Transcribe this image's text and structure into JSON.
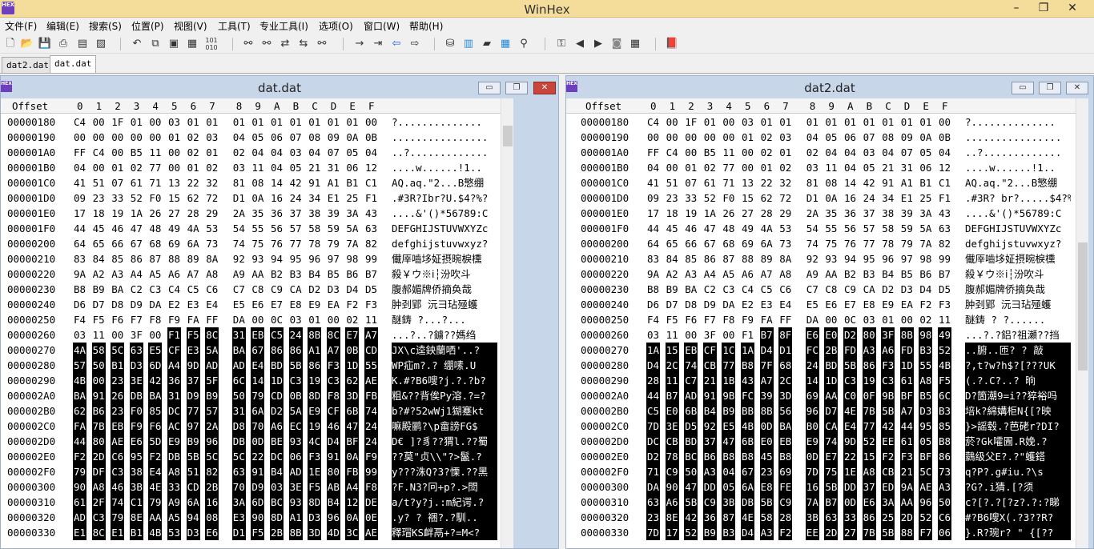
{
  "app": {
    "title": "WinHex",
    "logo_text": "HEX"
  },
  "window_controls": {
    "minimize": "–",
    "maximize": "❐",
    "close": "✕"
  },
  "menu": [
    "文件(F)",
    "编辑(E)",
    "搜索(S)",
    "位置(P)",
    "视图(V)",
    "工具(T)",
    "专业工具(I)",
    "选项(O)",
    "窗口(W)",
    "帮助(H)"
  ],
  "toolbar_icons": [
    "new-file-icon",
    "open-file-icon",
    "save-icon",
    "print-icon",
    "properties-icon",
    "open-folder-icon",
    "undo-icon",
    "copy-icon",
    "paste-icon",
    "clipboard-icon",
    "write-binary-icon",
    "find-text-icon",
    "find-hex-icon",
    "replace-text-icon",
    "replace-hex-icon",
    "find-again-icon",
    "goto-offset-icon",
    "goto-icon",
    "back-icon",
    "forward-icon",
    "disk-icon",
    "ram-icon",
    "memory-icon",
    "calculator-icon",
    "magnifier-icon",
    "toggle-icon",
    "prev-icon",
    "next-icon",
    "camera-icon",
    "table-icon",
    "book-icon"
  ],
  "tabs": [
    "dat2.dat",
    "dat.dat"
  ],
  "left": {
    "title": "dat.dat",
    "header": {
      "offset": "Offset",
      "cols": [
        "0",
        "1",
        "2",
        "3",
        "4",
        "5",
        "6",
        "7",
        "8",
        "9",
        "A",
        "B",
        "C",
        "D",
        "E",
        "F"
      ]
    },
    "offsets": [
      "00000180",
      "00000190",
      "000001A0",
      "000001B0",
      "000001C0",
      "000001D0",
      "000001E0",
      "000001F0",
      "00000200",
      "00000210",
      "00000220",
      "00000230",
      "00000240",
      "00000250",
      "00000260",
      "00000270",
      "00000280",
      "00000290",
      "000002A0",
      "000002B0",
      "000002C0",
      "000002D0",
      "000002E0",
      "000002F0",
      "00000300",
      "00000310",
      "00000320",
      "00000330"
    ],
    "rows": [
      "C4 00 1F 01 00 03 01 01 01 01 01 01 01 01 01 00",
      "00 00 00 00 00 01 02 03 04 05 06 07 08 09 0A 0B",
      "FF C4 00 B5 11 00 02 01 02 04 04 03 04 07 05 04",
      "04 00 01 02 77 00 01 02 03 11 04 05 21 31 06 12",
      "41 51 07 61 71 13 22 32 81 08 14 42 91 A1 B1 C1",
      "09 23 33 52 F0 15 62 72 D1 0A 16 24 34 E1 25 F1",
      "17 18 19 1A 26 27 28 29 2A 35 36 37 38 39 3A 43",
      "44 45 46 47 48 49 4A 53 54 55 56 57 58 59 5A 63",
      "64 65 66 67 68 69 6A 73 74 75 76 77 78 79 7A 82",
      "83 84 85 86 87 88 89 8A 92 93 94 95 96 97 98 99",
      "9A A2 A3 A4 A5 A6 A7 A8 A9 AA B2 B3 B4 B5 B6 B7",
      "B8 B9 BA C2 C3 C4 C5 C6 C7 C8 C9 CA D2 D3 D4 D5",
      "D6 D7 D8 D9 DA E2 E3 E4 E5 E6 E7 E8 E9 EA F2 F3",
      "F4 F5 F6 F7 F8 F9 FA FF DA 00 0C 03 01 00 02 11",
      "03 11 00 3F 00 F1 F5 8C 31 EB C5 24 8B 8C E7 A7",
      "4A 58 5C 63 E5 CF E3 5A BA 67 86 86 A1 A7 0B CD",
      "57 50 B1 D3 6D A4 9D AD AD E4 BD 5B 86 F3 1D 55",
      "4B 00 23 3E 42 36 37 5F 6C 14 1D C3 19 C3 62 AE",
      "BA 91 26 DB BA 31 D9 B9 50 79 CD 0B 8D F8 3D FB",
      "62 B6 23 F0 85 DC 77 57 31 6A D2 5A E9 CF 6B 74",
      "FA 7B EB F9 F6 AC 97 2A D8 70 A6 EC 19 46 47 24",
      "44 80 AE E6 5D E9 B9 96 DB 0D BE 93 4C D4 BF 24",
      "F2 2D C6 95 F2 DB 5B 5C 5C 22 DC 06 F3 91 0A F9",
      "79 DF C3 38 E4 A8 51 82 63 91 B4 AD 1E 80 FB 99",
      "90 A8 46 3B 4E 33 CD 2B 70 D9 03 3E F5 AB A4 F8",
      "61 2F 74 C1 79 A9 6A 16 3A 6D BC 93 8D B4 12 DE",
      "AD C3 79 8E AA A5 94 08 E3 90 8D A1 D3 96 0A 0E",
      "E1 8C E1 B1 4B 53 D3 E6 D1 F5 2B 8B 3D 4D 3C AE"
    ],
    "text": [
      "?..............",
      "................",
      "..?.............",
      "....w......!1..",
      "AQ.aq.\"2...B慜绷",
      ".#3R?Ibr?U.$4?%?",
      "....&'()*56789:C",
      "DEFGHIJSTUVWXYZc",
      "defghijstuvwxyz?",
      "儎厗嚙垑姃摂晼棙櫄",
      "殺￥ウ※ⅰ┆汾吹斗",
      "腹郝媚牌侨摘奂哉",
      "肿刭郢 沅彐玷殛蠖",
      "醚鋳  ?...?...",
      "...?..?鐪??媽绉",
      "JX\\c逵鉠蘭哂'..?",
      "WP疝m?.?  绷嗉.U",
      "K.#?B6嗖?j.?.?b?",
      "粗&??背俟Py溶.?=?",
      "b?#?52wWj1猢蹇kt",
      "嘛殿鹂?\\p畲謗FG$",
      "D€ ]?豸??猬l.??蜀",
      "??莫\"贞\\\\\"?>鬣.?",
      "y???洙Q?3?慄.??黑",
      "?F.N3?冋+p?.>閚",
      "a/t?y?j.:m紀谔.?",
      "  .y?  ?  祵?.?馴..",
      "釋瑁KS衅鬲+?=M<?"
    ]
  },
  "right": {
    "title": "dat2.dat",
    "header": {
      "offset": "Offset",
      "cols": [
        "0",
        "1",
        "2",
        "3",
        "4",
        "5",
        "6",
        "7",
        "8",
        "9",
        "A",
        "B",
        "C",
        "D",
        "E",
        "F"
      ]
    },
    "offsets": [
      "00000180",
      "00000190",
      "000001A0",
      "000001B0",
      "000001C0",
      "000001D0",
      "000001E0",
      "000001F0",
      "00000200",
      "00000210",
      "00000220",
      "00000230",
      "00000240",
      "00000250",
      "00000260",
      "00000270",
      "00000280",
      "00000290",
      "000002A0",
      "000002B0",
      "000002C0",
      "000002D0",
      "000002E0",
      "000002F0",
      "00000300",
      "00000310",
      "00000320",
      "00000330"
    ],
    "rows": [
      "C4 00 1F 01 00 03 01 01 01 01 01 01 01 01 01 00",
      "00 00 00 00 00 01 02 03 04 05 06 07 08 09 0A 0B",
      "FF C4 00 B5 11 00 02 01 02 04 04 03 04 07 05 04",
      "04 00 01 02 77 00 01 02 03 11 04 05 21 31 06 12",
      "41 51 07 61 71 13 22 32 81 08 14 42 91 A1 B1 C1",
      "09 23 33 52 F0 15 62 72 D1 0A 16 24 34 E1 25 F1",
      "17 18 19 1A 26 27 28 29 2A 35 36 37 38 39 3A 43",
      "44 45 46 47 48 49 4A 53 54 55 56 57 58 59 5A 63",
      "64 65 66 67 68 69 6A 73 74 75 76 77 78 79 7A 82",
      "83 84 85 86 87 88 89 8A 92 93 94 95 96 97 98 99",
      "9A A2 A3 A4 A5 A6 A7 A8 A9 AA B2 B3 B4 B5 B6 B7",
      "B8 B9 BA C2 C3 C4 C5 C6 C7 C8 C9 CA D2 D3 D4 D5",
      "D6 D7 D8 D9 DA E2 E3 E4 E5 E6 E7 E8 E9 EA F2 F3",
      "F4 F5 F6 F7 F8 F9 FA FF DA 00 0C 03 01 00 02 11",
      "03 11 00 3F 00 F1 B7 8F E6 E0 D2 80 3F 8B 98 49",
      "1A 15 EB CF 1C 1A D4 D1 FC 2B FD A3 A6 FD B3 52",
      "D4 2C 74 CB 77 B8 7F 68 24 BD 5B 86 F3 1D 55 4B",
      "28 11 C7 21 1B 43 A7 2C 14 1D C3 19 C3 61 A8 F5",
      "44 B7 AD 91 9B FC 39 3D 69 AA C0 0F 9B BF B5 6C",
      "C5 E0 6B B4 B9 BB 8B 56 96 D7 4E 7B 5B A7 D3 B3",
      "7D 3E D5 92 E5 4B 0D BA B0 CA E4 77 42 44 95 85",
      "DC CB BD 37 47 6B E0 EB E9 74 9D 52 EE 61 05 B8",
      "D2 78 BC B6 B8 B8 45 B8 0D E7 22 15 F2 F3 BF 86",
      "71 C9 50 A3 04 67 23 69 7D 75 1E A8 CB 21 5C 73",
      "DA 90 47 DD 05 6A E8 FE 16 5B DD 37 ED 9A AE A3",
      "63 A6 5B C9 3B DB 5B C9 7A B7 0D E6 3A AA 96 50",
      "23 8E 42 36 87 4E 58 28 3B 63 33 86 25 2D 52 C6",
      "7D 17 52 B9 B3 D4 A3 F2 EE 2D 27 7B 5B 88 F7 06"
    ],
    "text": [
      "?..............",
      "................",
      "..?.............",
      "....w......!1..",
      "AQ.aq.\"2...B慜绷",
      ".#3R? br?.....$4?%?",
      "....&'()*56789:C",
      "DEFGHIJSTUVWXYZc",
      "defghijstuvwxyz?",
      "儎厗嚙垑姃摂晼棙櫄",
      "殺￥ウ※ⅰ┆汾吹斗",
      "腹郝媚牌侨摘奂哉",
      "肿刭郢 沅彐玷殛蠖",
      "醚鋳  ?  ?......",
      "...?.?鋁?祖瀬??挡",
      "..腑..匝?  ?  敲",
      "?,t?w?h$?[???UK",
      "(.?.C?..?  晌",
      "D?箇潮9=i??猝裕吗",
      "培k?綿媾柜N{[?映",
      "}>謡毂.?芭硓r?DI?",
      "菸?Gk嚯圊.R娩.?",
      "鸏级父E?.?\"蠖鎝",
      "q?P?.g#iu.?\\s",
      "?G?.i猜.[?须",
      "c?[?.?[?z?.?:?睇",
      "#?B6嗖X(.?3??R?",
      "}.R?琬r? \" {[??"
    ]
  }
}
